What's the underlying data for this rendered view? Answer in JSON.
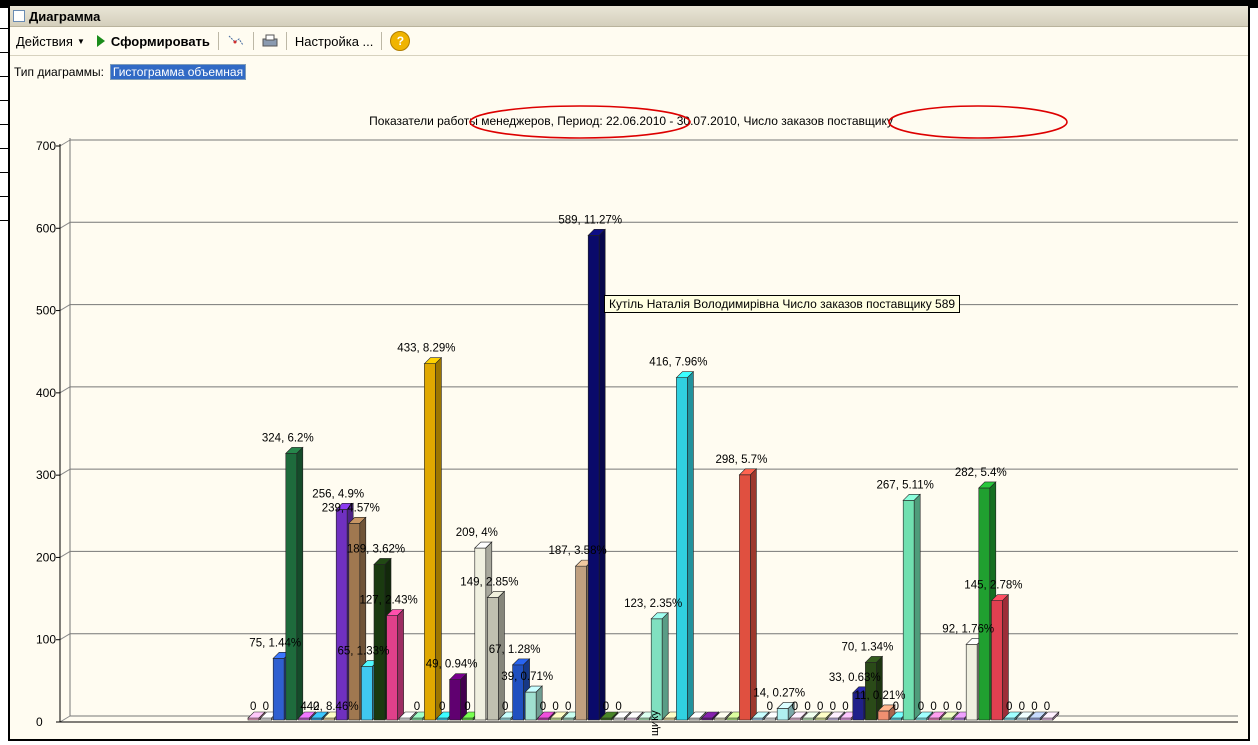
{
  "window": {
    "title": "Диаграмма"
  },
  "toolbar": {
    "actions_label": "Действия",
    "generate_label": "Сформировать",
    "settings_label": "Настройка ...",
    "help_label": "?"
  },
  "chart_type": {
    "label": "Тип диаграммы:",
    "value": "Гистограмма объемная"
  },
  "chart_data": {
    "type": "bar",
    "title": "Показатели работы менеджеров, Период: 22.06.2010 - 30.07.2010, Число заказов поставщику",
    "ylim": [
      0,
      700
    ],
    "yticks": [
      0,
      100,
      200,
      300,
      400,
      500,
      600,
      700
    ],
    "grid": true,
    "xlabel": "щику",
    "values": [
      0,
      0,
      75,
      324,
      0,
      0,
      0,
      256,
      239,
      65,
      189,
      127,
      0,
      0,
      433,
      0,
      49,
      0,
      209,
      149,
      0,
      67,
      34,
      0,
      0,
      0,
      187,
      589,
      0,
      0,
      0,
      0,
      123,
      0,
      416,
      0,
      0,
      0,
      0,
      298,
      0,
      0,
      14,
      0,
      0,
      0,
      0,
      0,
      33,
      70,
      11,
      0,
      267,
      0,
      0,
      0,
      0,
      92,
      282,
      145,
      0,
      0,
      0,
      0
    ],
    "labels": [
      "",
      "",
      "75, 1.44%",
      "324, 6.2%",
      "442, 8.46%",
      "",
      "",
      "256, 4.9%",
      "239, 4.57%",
      "65, 1.33%",
      "189, 3.62%",
      "127, 2.43%",
      "",
      "",
      "433, 8.29%",
      "",
      "49, 0.94%",
      "",
      "209, 4%",
      "149, 2.85%",
      "",
      "67, 1.28%",
      "39, 0.71%",
      "",
      "",
      "",
      "187, 3.58%",
      "589, 11.27%",
      "",
      "",
      "",
      "",
      "123, 2.35%",
      "",
      "416, 7.96%",
      "",
      "",
      "",
      "",
      "298, 5.7%",
      "",
      "",
      "14, 0.27%",
      "",
      "",
      "",
      "",
      "",
      "33, 0.63%",
      "70, 1.34%",
      "11, 0.21%",
      "",
      "267, 5.11%",
      "",
      "",
      "",
      "",
      "92, 1.76%",
      "282, 5.4%",
      "145, 2.78%",
      "",
      "",
      "",
      ""
    ],
    "colors": [
      "#f5a0c8",
      "#f0f0f0",
      "#2f5fd0",
      "#1e6b3c",
      "#c060d0",
      "#30a0e0",
      "#f0d8a0",
      "#7030c0",
      "#a07850",
      "#40c8f0",
      "#1a3a10",
      "#e0408a",
      "#f0f0f0",
      "#80e8a0",
      "#e0a800",
      "#30d0f0",
      "#600070",
      "#60e040",
      "#f0f0e0",
      "#c0c0b0",
      "#a0e8f0",
      "#2050c0",
      "#a0e0d0",
      "#c040b0",
      "#d0f0a0",
      "#a0d8c0",
      "#c0a080",
      "#0a0a6a",
      "#3a6a20",
      "#e0e0e0",
      "#f0d0f0",
      "#b0f0c0",
      "#80e0c0",
      "#f0e0a0",
      "#30d0e0",
      "#d0d0d0",
      "#6a1a8a",
      "#e0e0c0",
      "#b0f080",
      "#e05040",
      "#a0d0f0",
      "#f0f0f0",
      "#b0f0f0",
      "#f0c0e0",
      "#c0f0c0",
      "#e0f0a0",
      "#d0c0f0",
      "#f0a0f0",
      "#20208a",
      "#2a4a18",
      "#f09070",
      "#60d0e0",
      "#70e0b0",
      "#80f0f0",
      "#f080c0",
      "#c0f0a0",
      "#c080f0",
      "#f0f0e0",
      "#20a030",
      "#e04050",
      "#80e0f0",
      "#c0e0f0",
      "#a0b0f0",
      "#f0c0f0"
    ]
  },
  "tooltip": "Кутіль Наталія Володимирівна Число заказов поставщику 589"
}
